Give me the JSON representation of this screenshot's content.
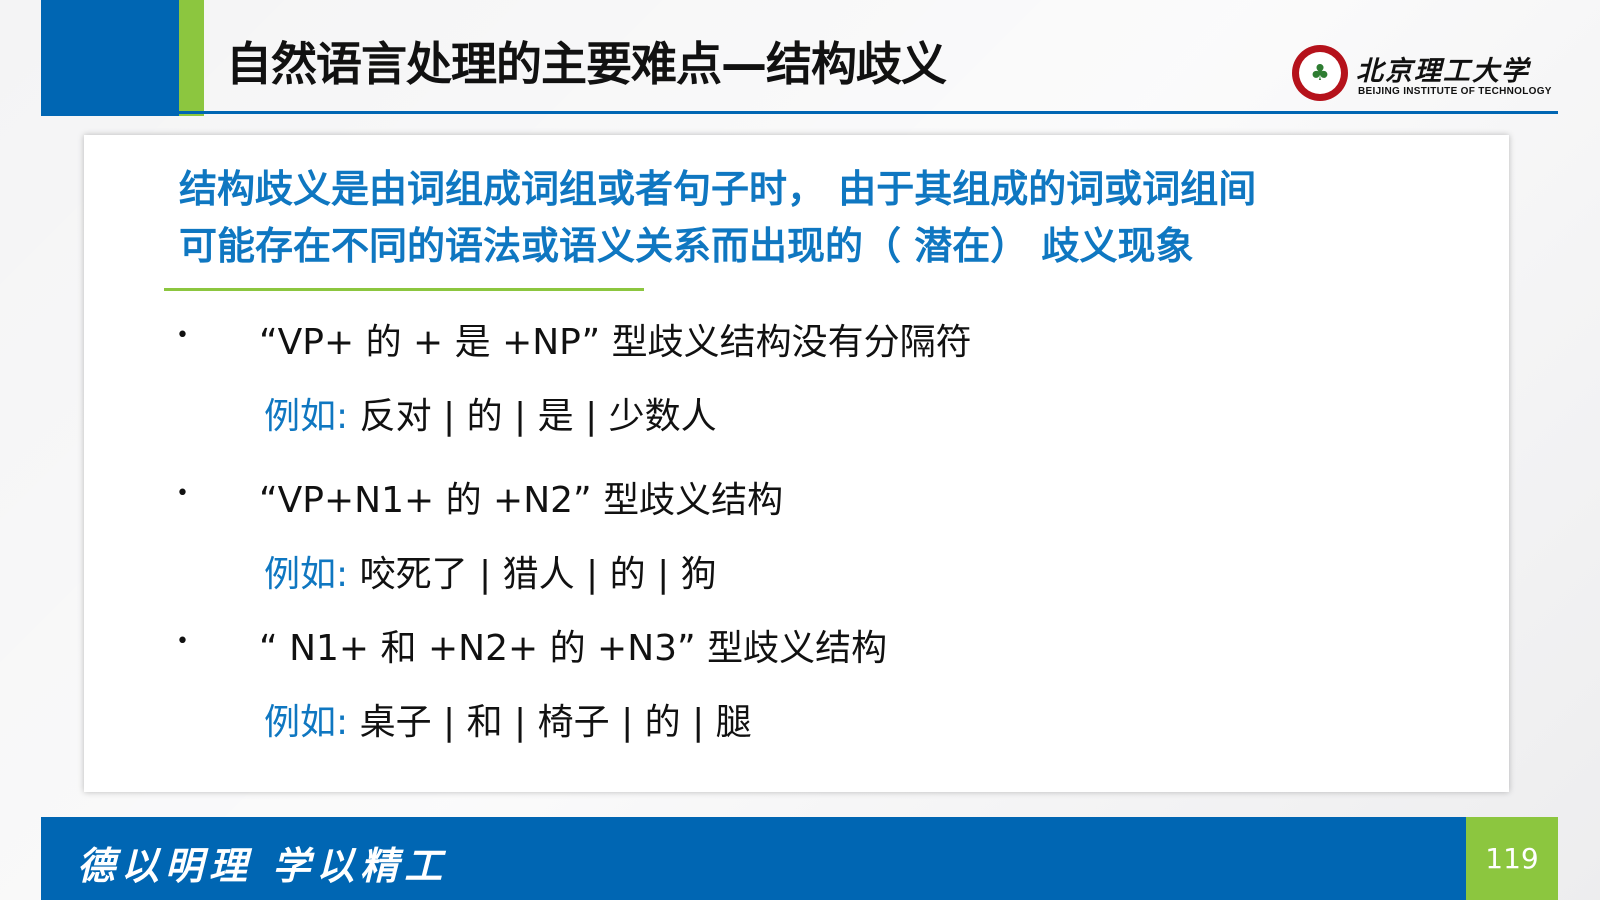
{
  "header": {
    "title": "自然语言处理的主要难点—结构歧义"
  },
  "logo": {
    "name_cn": "北京理工大学",
    "name_en": "BEIJING INSTITUTE OF TECHNOLOGY",
    "emblem_icon": "university-emblem-icon"
  },
  "content": {
    "definition_line1": "结构歧义是由词组成词组或者句子时， 由于其组成的词或词组间",
    "definition_line2": "可能存在不同的语法或语义关系而出现的（ 潜在） 歧义现象",
    "bullet_symbol": "•",
    "items": [
      {
        "pattern": "“VP+ 的 + 是 +NP” 型歧义结构没有分隔符",
        "example_label": "例如:",
        "example_text": "反对 | 的 | 是 | 少数人"
      },
      {
        "pattern": "“VP+N1+ 的 +N2” 型歧义结构",
        "example_label": "例如:",
        "example_text": "咬死了 | 猎人 | 的 | 狗"
      },
      {
        "pattern": "“ N1+ 和 +N2+ 的 +N3” 型歧义结构",
        "example_label": "例如:",
        "example_text": "桌子 | 和 | 椅子 | 的 | 腿"
      }
    ]
  },
  "footer": {
    "motto": "德以明理 学以精工",
    "page_number": "119"
  },
  "colors": {
    "brand_blue": "#0066b3",
    "accent_green": "#8cc63f",
    "text_blue": "#0f77c1",
    "emblem_red": "#b5121b"
  }
}
